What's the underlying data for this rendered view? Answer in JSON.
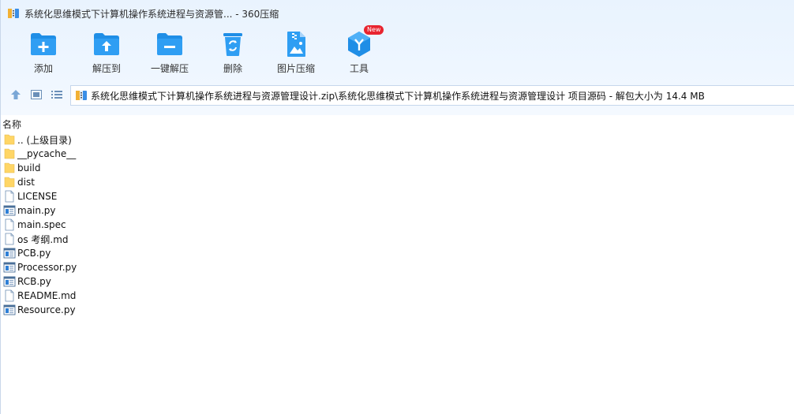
{
  "window": {
    "title": "系统化思维模式下计算机操作系统进程与资源管... - 360压缩"
  },
  "toolbar": {
    "items": [
      {
        "label": "添加",
        "icon": "folder-add-icon"
      },
      {
        "label": "解压到",
        "icon": "folder-extract-icon"
      },
      {
        "label": "一键解压",
        "icon": "folder-quick-extract-icon"
      },
      {
        "label": "删除",
        "icon": "recycle-bin-icon"
      },
      {
        "label": "图片压缩",
        "icon": "image-compress-icon"
      },
      {
        "label": "工具",
        "icon": "tools-cube-icon",
        "badge": "New"
      }
    ]
  },
  "nav": {
    "path": "系统化思维模式下计算机操作系统进程与资源管理设计.zip\\系统化思维模式下计算机操作系统进程与资源管理设计 项目源码 - 解包大小为 14.4 MB"
  },
  "list": {
    "column_name": "名称",
    "files": [
      {
        "name": ".. (上级目录)",
        "type": "folder"
      },
      {
        "name": "__pycache__",
        "type": "folder"
      },
      {
        "name": "build",
        "type": "folder"
      },
      {
        "name": "dist",
        "type": "folder"
      },
      {
        "name": "LICENSE",
        "type": "file"
      },
      {
        "name": "main.py",
        "type": "py"
      },
      {
        "name": "main.spec",
        "type": "file"
      },
      {
        "name": "os 考纲.md",
        "type": "file"
      },
      {
        "name": "PCB.py",
        "type": "py"
      },
      {
        "name": "Processor.py",
        "type": "py"
      },
      {
        "name": "RCB.py",
        "type": "py"
      },
      {
        "name": "README.md",
        "type": "file"
      },
      {
        "name": "Resource.py",
        "type": "py"
      }
    ]
  },
  "colors": {
    "accent": "#1f8ee6",
    "folder": "#ffd666",
    "badge": "#e8242f"
  }
}
